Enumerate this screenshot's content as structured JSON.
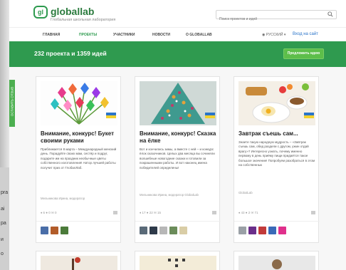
{
  "header": {
    "logo_mark": "gl",
    "logo_text": "globallab",
    "logo_sub": "Глобальная школьная лаборатория",
    "search_placeholder": "Поиск проектов и идей"
  },
  "nav": {
    "items": [
      "ГЛАВНАЯ",
      "ПРОЕКТЫ",
      "УЧАСТНИКИ",
      "НОВОСТИ",
      "О GLOBALLAB"
    ],
    "active_index": 1,
    "language": "РУССКИЙ",
    "login": "Вход на сайт"
  },
  "banner": {
    "title": "232 проекта и 1359 идей",
    "button": "Предложить идею"
  },
  "sidetab": {
    "label": "ОСТАВИТЬ ОТЗЫВ"
  },
  "left_strip": {
    "lines": [
      "pra",
      "ai",
      "ра",
      "и",
      "о"
    ]
  },
  "cards": [
    {
      "title": "Внимание, конкурс! Букет своими руками",
      "text": "Приближается 8 марта – Международный женский день. Порадуйте своих мам, сестёр и подруг, подарите им на праздник необычные цветы собственного изготовления! Автор лучшей работы получит приз от ГлобалЛаб.",
      "author": "Мельникова Ирина, модератор",
      "stats": "♦ 6   ● 0   ✉ 0"
    },
    {
      "title": "Внимание, конкурс! Сказка на ёлке",
      "text": "Вот и кончились зимы, а вместе с ней – и конкурс ёлок сказочников. Целых два месяца вы сочиняли волшебные новогодние сказки и готовили за покрашенными работы. И вот наконец имена победителей определены!",
      "author": "Мельникова Ирина, модератор GlobalLab",
      "stats": "♦ 17   ● 22   ✉ 15"
    },
    {
      "title": "Завтрак съешь сам...",
      "text": "Знаете такую народную мудрость – «Завтрак съешь сам, обед раздели с другом, ужин отдай врагу»? Интересно узнать, почему именно первому в день приёму пищи придаётся такое большое значение! Попробуем разобраться в этом на собственных",
      "author": "GlobalLab",
      "stats": "♦ 43   ● 2   ✉ 71"
    }
  ],
  "colors": {
    "brand_green": "#2f9a4f",
    "button_green": "#5dbe4a",
    "link_blue": "#2a74c9"
  }
}
